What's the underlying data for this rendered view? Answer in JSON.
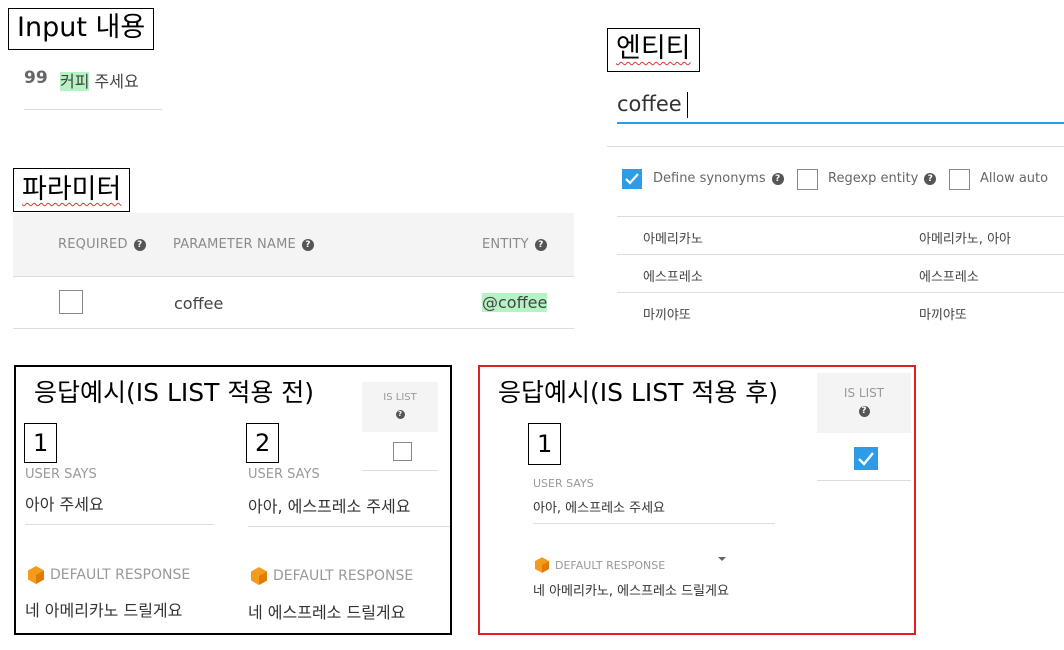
{
  "labels": {
    "input": "Input 내용",
    "entity": "엔티티",
    "params": "파라미터",
    "resp_before": "응답예시(IS LIST 적용 전)",
    "resp_after": "응답예시(IS LIST 적용 후)"
  },
  "input": {
    "quote_icon": "99",
    "text_hl": "커피",
    "text_rest": " 주세요"
  },
  "entity": {
    "name_value": "coffee",
    "options": [
      {
        "label": "Define synonyms",
        "checked": true
      },
      {
        "label": "Regexp entity",
        "checked": false
      },
      {
        "label": "Allow auto",
        "checked": false
      }
    ],
    "rows": [
      {
        "value": "아메리카노",
        "synonyms": "아메리카노, 아아"
      },
      {
        "value": "에스프레소",
        "synonyms": "에스프레소"
      },
      {
        "value": "마끼야또",
        "synonyms": "마끼야또"
      }
    ]
  },
  "params": {
    "col_required": "REQUIRED",
    "col_name": "PARAMETER NAME",
    "col_entity": "ENTITY",
    "row": {
      "name": "coffee",
      "entity": "@coffee",
      "required": false
    }
  },
  "before": {
    "islist_header": "IS LIST",
    "islist_checked": false,
    "examples": [
      {
        "num": "1",
        "user_says_label": "USER SAYS",
        "user_says": "아아 주세요",
        "response_label": "DEFAULT RESPONSE",
        "response": "네 아메리카노 드릴게요"
      },
      {
        "num": "2",
        "user_says_label": "USER SAYS",
        "user_says": "아아, 에스프레소 주세요",
        "response_label": "DEFAULT RESPONSE",
        "response": "네 에스프레소 드릴게요"
      }
    ]
  },
  "after": {
    "islist_header": "IS LIST",
    "islist_checked": true,
    "example": {
      "num": "1",
      "user_says_label": "USER SAYS",
      "user_says": "아아, 에스프레소 주세요",
      "response_label": "DEFAULT RESPONSE",
      "response": "네 아메리카노, 에스프레소 드릴게요"
    }
  },
  "colors": {
    "accent": "#2d9be6",
    "highlight": "#b6f3c4",
    "red_frame": "#e02020",
    "cube": "#f59b1b"
  }
}
